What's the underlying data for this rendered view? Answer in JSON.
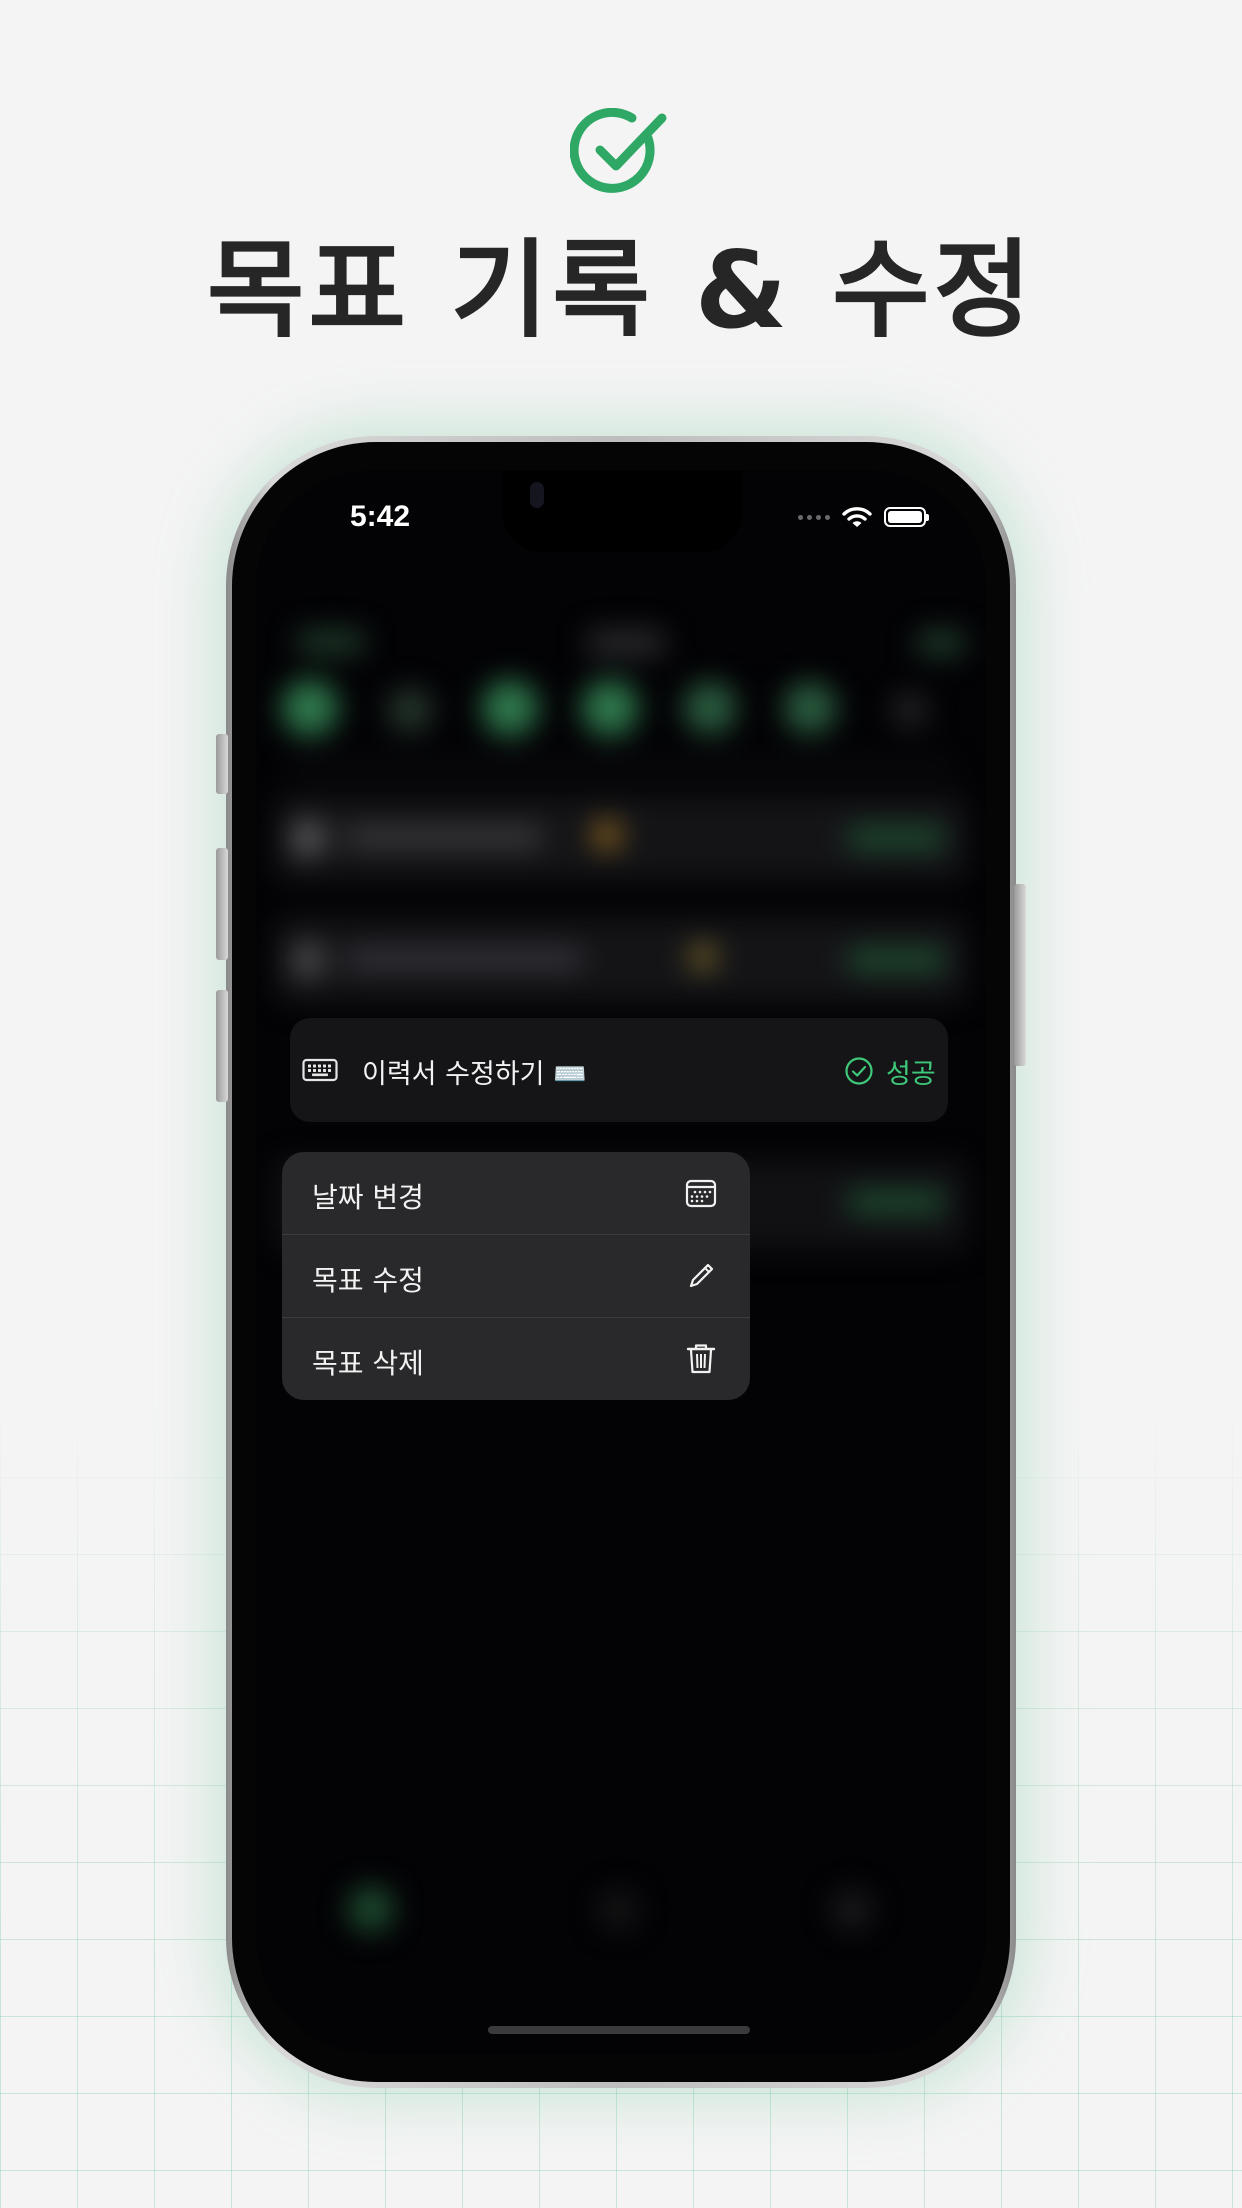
{
  "header": {
    "title": "목표 기록 & 수정",
    "icon": "check-circle-icon",
    "accent_color": "#2fa866"
  },
  "status_bar": {
    "time": "5:42"
  },
  "goal": {
    "text": "이력서 수정하기 ⌨️",
    "icon": "keyboard-icon",
    "status_label": "성공",
    "status_icon": "check-circle-icon",
    "status_color": "#3ec97a"
  },
  "context_menu": {
    "items": [
      {
        "label": "날짜 변경",
        "icon": "calendar-icon"
      },
      {
        "label": "목표 수정",
        "icon": "pencil-icon"
      },
      {
        "label": "목표 삭제",
        "icon": "trash-icon"
      }
    ]
  }
}
